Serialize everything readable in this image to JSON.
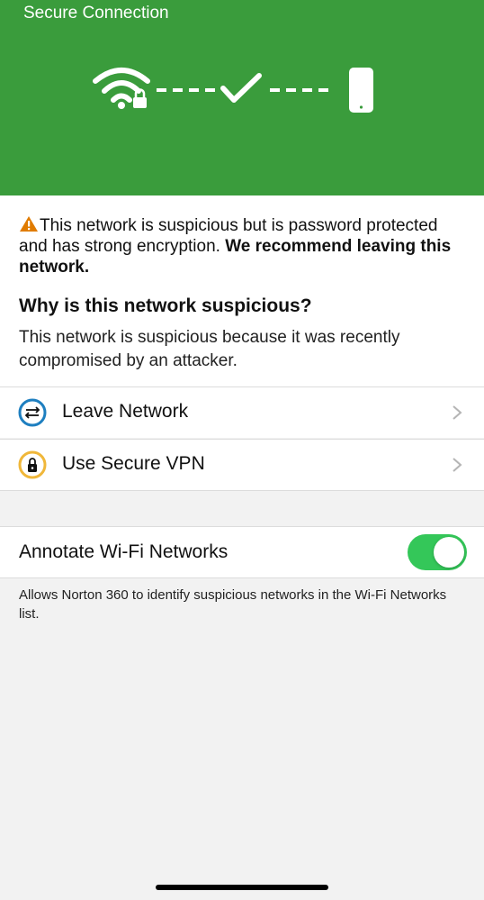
{
  "header": {
    "title": "Secure Connection",
    "color": "#3a9c3c"
  },
  "warning": {
    "text_plain": "This network is suspicious but is password protected and has strong encryption. ",
    "text_bold": "We recommend leaving this network.",
    "icon": "warning-triangle-icon",
    "icon_color": "#e07b00"
  },
  "reason": {
    "title": "Why is this network suspicious?",
    "body": "This network is suspicious because it was recently compromised by an attacker."
  },
  "actions": [
    {
      "label": "Leave Network",
      "icon": "leave-network-icon"
    },
    {
      "label": "Use Secure VPN",
      "icon": "secure-vpn-icon"
    }
  ],
  "settings": {
    "annotate_label": "Annotate Wi-Fi Networks",
    "annotate_enabled": true,
    "footnote": "Allows Norton 360 to identify suspicious networks in the Wi-Fi Networks list.",
    "toggle_color": "#34c759"
  }
}
